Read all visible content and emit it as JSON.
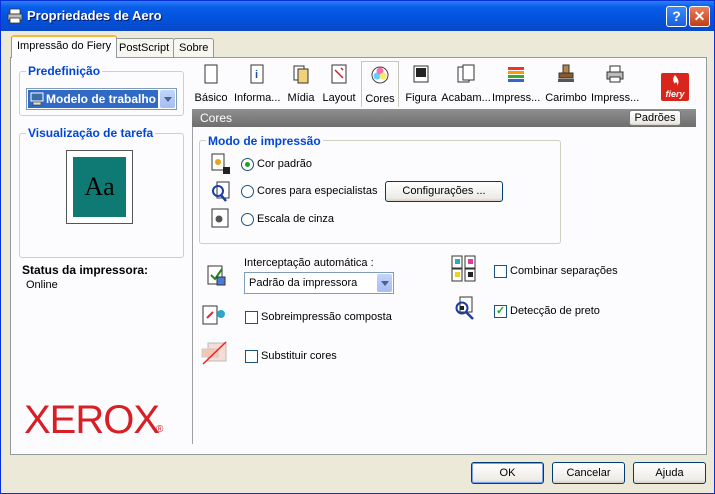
{
  "window": {
    "title": "Propriedades de Aero",
    "help_label": "?",
    "close_label": "✕"
  },
  "tabs": [
    {
      "label": "Impressão do Fiery",
      "active": true
    },
    {
      "label": "PostScript",
      "active": false
    },
    {
      "label": "Sobre",
      "active": false
    }
  ],
  "sidebar": {
    "preset_title": "Predefinição",
    "preset_value": "Modelo de trabalho",
    "preview_title": "Visualização de tarefa",
    "preview_text": "Aa",
    "status_title": "Status da impressora:",
    "status_value": "Online",
    "brand": "XEROX",
    "brand_mark": "®"
  },
  "toolbar": [
    {
      "label": "Básico",
      "icon": "page-icon"
    },
    {
      "label": "Informa...",
      "icon": "info-icon"
    },
    {
      "label": "Mídia",
      "icon": "media-icon"
    },
    {
      "label": "Layout",
      "icon": "layout-icon"
    },
    {
      "label": "Cores",
      "icon": "color-wheel-icon",
      "active": true
    },
    {
      "label": "Figura",
      "icon": "image-icon"
    },
    {
      "label": "Acabam...",
      "icon": "finishing-icon"
    },
    {
      "label": "Impress...",
      "icon": "print-stack-icon"
    },
    {
      "label": "Carimbo",
      "icon": "stamp-icon"
    },
    {
      "label": "Impress...",
      "icon": "printer-icon"
    }
  ],
  "fiery_logo": "fiery",
  "panel": {
    "title": "Cores",
    "defaults_button": "Padrões",
    "print_mode": {
      "title": "Modo de impressão",
      "options": [
        {
          "label": "Cor padrão",
          "selected": true
        },
        {
          "label": "Cores para especialistas",
          "selected": false
        },
        {
          "label": "Escala de cinza",
          "selected": false
        }
      ],
      "config_button": "Configurações ..."
    },
    "trapping": {
      "label": "Interceptação automática :",
      "value": "Padrão da impressora"
    },
    "composite_overprint": {
      "label": "Sobreimpressão composta",
      "checked": false
    },
    "replace_colors": {
      "label": "Substituir cores",
      "checked": false
    },
    "combine_separations": {
      "label": "Combinar separações",
      "checked": false
    },
    "black_detection": {
      "label": "Detecção de preto",
      "checked": true
    }
  },
  "footer": {
    "ok": "OK",
    "cancel": "Cancelar",
    "help": "Ajuda"
  },
  "colors": {
    "titlebar": "#0a5ee8",
    "group_title": "#0046d5",
    "brand": "#d81f26",
    "preview_bg": "#0f7a74"
  }
}
